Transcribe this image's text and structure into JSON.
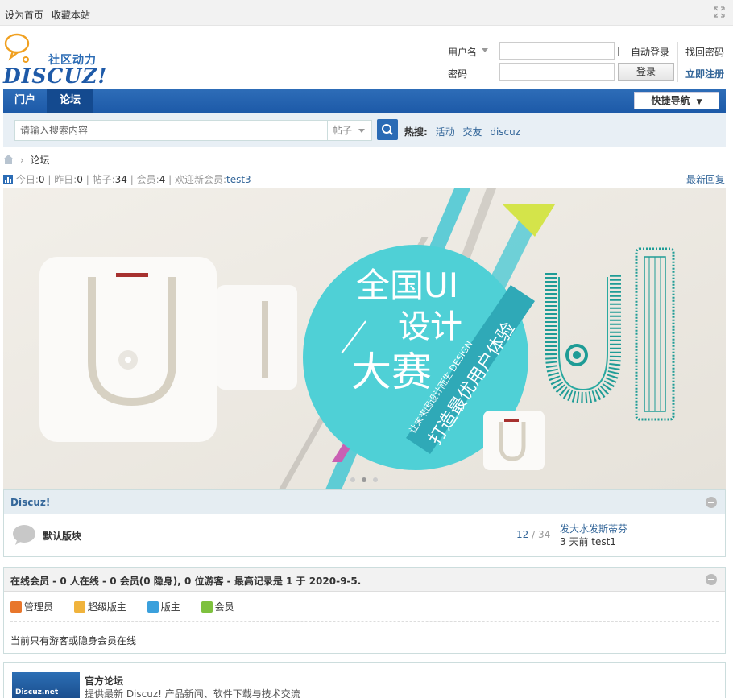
{
  "topbar": {
    "set_home": "设为首页",
    "bookmark": "收藏本站"
  },
  "header": {
    "brand_tagline": "社区动力",
    "brand_name": "DISCUZ!",
    "username_label": "用户名",
    "password_label": "密码",
    "auto_login": "自动登录",
    "login_button": "登录",
    "forgot_password": "找回密码",
    "register": "立即注册"
  },
  "nav": {
    "items": [
      "门户",
      "论坛"
    ],
    "quick_nav": "快捷导航"
  },
  "search": {
    "placeholder": "请输入搜索内容",
    "type": "帖子",
    "hot_label": "热搜:",
    "hot_words": [
      "活动",
      "交友",
      "discuz"
    ]
  },
  "breadcrumb": {
    "current": "论坛"
  },
  "stats": {
    "today_label": "今日:",
    "today": "0",
    "yesterday_label": "昨日:",
    "yesterday": "0",
    "posts_label": "帖子:",
    "posts": "34",
    "members_label": "会员:",
    "members": "4",
    "welcome_label": "欢迎新会员:",
    "newest_member": "test3",
    "latest_replies": "最新回复"
  },
  "banner": {
    "line1": "全国UI",
    "line2": "设计",
    "line3": "大赛",
    "ribbon1": "打造最优用户体验",
    "ribbon2": "让未来因设计而生 DESIGN"
  },
  "category": {
    "title": "Discuz!",
    "forum": {
      "name": "默认版块",
      "threads": "12",
      "posts": "34",
      "last_title": "发大水发斯蒂芬",
      "last_meta": "3 天前 test1"
    }
  },
  "online": {
    "title": "在线会员 - 0 人在线 - 0 会员(0 隐身), 0 位游客 - 最高记录是 1 于 2020-9-5.",
    "legend": [
      "管理员",
      "超级版主",
      "版主",
      "会员"
    ],
    "note": "当前只有游客或隐身会员在线"
  },
  "friend_link": {
    "logo_text": "Discuz.net",
    "name": "官方论坛",
    "desc": "提供最新 Discuz! 产品新闻、软件下载与技术交流"
  },
  "colors": {
    "nav_blue": "#1d5aa8",
    "link_blue": "#336699",
    "banner_cyan": "#4fd0d6"
  }
}
